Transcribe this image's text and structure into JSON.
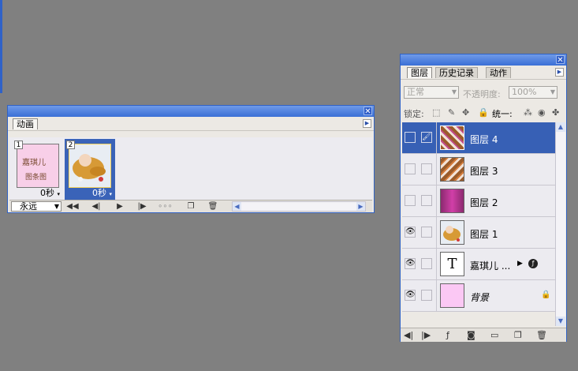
{
  "animation_panel": {
    "tab_label": "动画",
    "frames": [
      {
        "number": "1",
        "delay": "0秒",
        "thumb_text": [
          "嘉琪儿",
          "图条图"
        ],
        "selected": false
      },
      {
        "number": "2",
        "delay": "0秒",
        "selected": true
      }
    ],
    "loop_value": "永远"
  },
  "layers_panel": {
    "tabs": [
      "图层",
      "历史记录",
      "动作"
    ],
    "blend_mode": "正常",
    "opacity_label": "不透明度:",
    "opacity_value": "100%",
    "lock_label": "锁定:",
    "unify_label": "统一:",
    "layers": [
      {
        "name": "图层 4",
        "visible": false,
        "selected": true,
        "thumb": "brown-lace",
        "linked_brush": true
      },
      {
        "name": "图层 3",
        "visible": false,
        "selected": false,
        "thumb": "brown-lace"
      },
      {
        "name": "图层 2",
        "visible": false,
        "selected": false,
        "thumb": "magenta"
      },
      {
        "name": "图层 1",
        "visible": true,
        "selected": false,
        "thumb": "baby-photo"
      },
      {
        "name": "嘉琪儿 ...",
        "visible": true,
        "selected": false,
        "thumb": "text",
        "thumb_glyph": "T"
      },
      {
        "name": "背景",
        "visible": true,
        "selected": false,
        "thumb": "pink"
      }
    ]
  },
  "colors": {
    "workspace": "#808080",
    "panel_bg": "#ece9e4",
    "selection_blue": "#3760b5",
    "title_blue": "#3a6fd6"
  }
}
